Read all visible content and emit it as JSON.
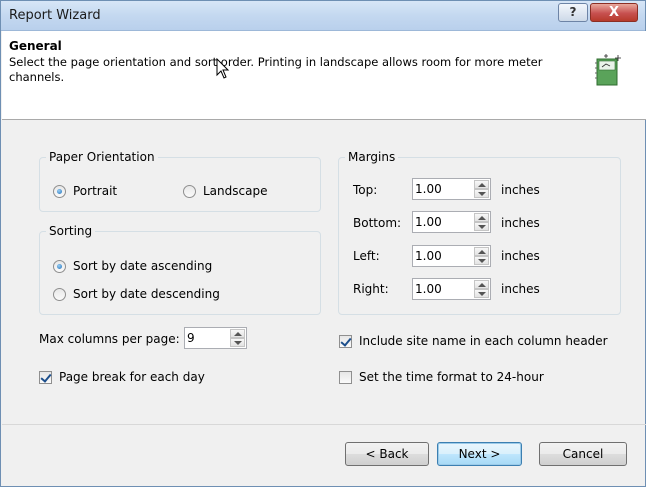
{
  "window": {
    "title": "Report Wizard",
    "help_label": "?",
    "close_label": "X"
  },
  "header": {
    "title": "General",
    "description": "Select the page orientation and sort order. Printing in landscape allows room for more meter channels.",
    "icon": "wizard-page-icon"
  },
  "paper_orientation": {
    "legend": "Paper Orientation",
    "options": [
      {
        "label": "Portrait",
        "checked": true
      },
      {
        "label": "Landscape",
        "checked": false
      }
    ]
  },
  "sorting": {
    "legend": "Sorting",
    "options": [
      {
        "label": "Sort by date ascending",
        "checked": true
      },
      {
        "label": "Sort by date descending",
        "checked": false
      }
    ]
  },
  "margins": {
    "legend": "Margins",
    "unit": "inches",
    "rows": [
      {
        "label": "Top:",
        "value": "1.00"
      },
      {
        "label": "Bottom:",
        "value": "1.00"
      },
      {
        "label": "Left:",
        "value": "1.00"
      },
      {
        "label": "Right:",
        "value": "1.00"
      }
    ]
  },
  "max_columns": {
    "label": "Max columns per page:",
    "value": "9"
  },
  "options": {
    "page_break": {
      "label": "Page break for each day",
      "checked": true
    },
    "site_name": {
      "label": "Include site name in each column header",
      "checked": true
    },
    "time_format": {
      "label": "Set the time format to 24-hour",
      "checked": false
    }
  },
  "buttons": {
    "back": "< Back",
    "next": "Next >",
    "cancel": "Cancel"
  },
  "colors": {
    "title_bar": "#c4d8f0",
    "close_button": "#c75050",
    "dialog_bg": "#f0f0f0",
    "accent": "#3c7fb1"
  }
}
